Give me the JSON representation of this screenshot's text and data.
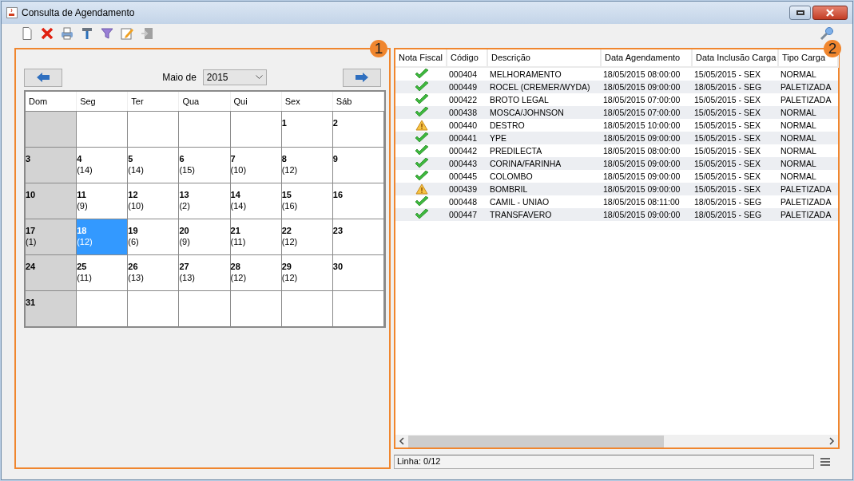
{
  "window": {
    "title": "Consulta de Agendamento"
  },
  "callouts": [
    "1",
    "2"
  ],
  "calendar": {
    "month_label": "Maio de",
    "year": "2015",
    "weekdays": [
      "Dom",
      "Seg",
      "Ter",
      "Qua",
      "Qui",
      "Sex",
      "Sáb"
    ],
    "weeks": [
      [
        {
          "kind": "blank"
        },
        {
          "kind": "blank"
        },
        {
          "kind": "blank"
        },
        {
          "kind": "blank"
        },
        {
          "kind": "blank"
        },
        {
          "kind": "day",
          "day": "1",
          "selected": false
        },
        {
          "kind": "day",
          "day": "2",
          "selected": false
        }
      ],
      [
        {
          "kind": "day",
          "day": "3",
          "selected": false
        },
        {
          "kind": "day",
          "day": "4",
          "count": "(14)",
          "selected": false
        },
        {
          "kind": "day",
          "day": "5",
          "count": "(14)",
          "selected": false
        },
        {
          "kind": "day",
          "day": "6",
          "count": "(15)",
          "selected": false
        },
        {
          "kind": "day",
          "day": "7",
          "count": "(10)",
          "selected": false
        },
        {
          "kind": "day",
          "day": "8",
          "count": "(12)",
          "selected": false
        },
        {
          "kind": "day",
          "day": "9",
          "selected": false
        }
      ],
      [
        {
          "kind": "day",
          "day": "10",
          "selected": false
        },
        {
          "kind": "day",
          "day": "11",
          "count": "(9)",
          "selected": false
        },
        {
          "kind": "day",
          "day": "12",
          "count": "(10)",
          "selected": false
        },
        {
          "kind": "day",
          "day": "13",
          "count": "(2)",
          "selected": false
        },
        {
          "kind": "day",
          "day": "14",
          "count": "(14)",
          "selected": false
        },
        {
          "kind": "day",
          "day": "15",
          "count": "(16)",
          "selected": false
        },
        {
          "kind": "day",
          "day": "16",
          "selected": false
        }
      ],
      [
        {
          "kind": "day",
          "day": "17",
          "count": "(1)",
          "selected": false
        },
        {
          "kind": "day",
          "day": "18",
          "count": "(12)",
          "selected": true
        },
        {
          "kind": "day",
          "day": "19",
          "count": "(6)",
          "selected": false
        },
        {
          "kind": "day",
          "day": "20",
          "count": "(9)",
          "selected": false
        },
        {
          "kind": "day",
          "day": "21",
          "count": "(11)",
          "selected": false
        },
        {
          "kind": "day",
          "day": "22",
          "count": "(12)",
          "selected": false
        },
        {
          "kind": "day",
          "day": "23",
          "selected": false
        }
      ],
      [
        {
          "kind": "day",
          "day": "24",
          "selected": false
        },
        {
          "kind": "day",
          "day": "25",
          "count": "(11)",
          "selected": false
        },
        {
          "kind": "day",
          "day": "26",
          "count": "(13)",
          "selected": false
        },
        {
          "kind": "day",
          "day": "27",
          "count": "(13)",
          "selected": false
        },
        {
          "kind": "day",
          "day": "28",
          "count": "(12)",
          "selected": false
        },
        {
          "kind": "day",
          "day": "29",
          "count": "(12)",
          "selected": false
        },
        {
          "kind": "day",
          "day": "30",
          "selected": false
        }
      ],
      [
        {
          "kind": "day",
          "day": "31",
          "selected": false
        },
        {
          "kind": "blank"
        },
        {
          "kind": "blank"
        },
        {
          "kind": "blank"
        },
        {
          "kind": "blank"
        },
        {
          "kind": "blank"
        },
        {
          "kind": "blank"
        }
      ]
    ]
  },
  "table": {
    "columns": [
      "Nota Fiscal",
      "Código",
      "Descrição",
      "Data Agendamento",
      "Data Inclusão Carga",
      "Tipo Carga"
    ],
    "rows": [
      {
        "kind": "ok",
        "code": "000404",
        "description": "MELHORAMENTO",
        "scheduled": "18/05/2015 08:00:00",
        "included": "15/05/2015 - SEX",
        "load_type": "NORMAL"
      },
      {
        "kind": "ok",
        "code": "000449",
        "description": "ROCEL (CREMER/WYDA)",
        "scheduled": "18/05/2015 09:00:00",
        "included": "18/05/2015 - SEG",
        "load_type": "PALETIZADA"
      },
      {
        "kind": "ok",
        "code": "000422",
        "description": "BROTO LEGAL",
        "scheduled": "18/05/2015 07:00:00",
        "included": "15/05/2015 - SEX",
        "load_type": "PALETIZADA"
      },
      {
        "kind": "ok",
        "code": "000438",
        "description": "MOSCA/JOHNSON",
        "scheduled": "18/05/2015 07:00:00",
        "included": "15/05/2015 - SEX",
        "load_type": "NORMAL"
      },
      {
        "kind": "warning",
        "code": "000440",
        "description": "DESTRO",
        "scheduled": "18/05/2015 10:00:00",
        "included": "15/05/2015 - SEX",
        "load_type": "NORMAL"
      },
      {
        "kind": "ok",
        "code": "000441",
        "description": "YPE",
        "scheduled": "18/05/2015 09:00:00",
        "included": "15/05/2015 - SEX",
        "load_type": "NORMAL"
      },
      {
        "kind": "ok",
        "code": "000442",
        "description": "PREDILECTA",
        "scheduled": "18/05/2015 08:00:00",
        "included": "15/05/2015 - SEX",
        "load_type": "NORMAL"
      },
      {
        "kind": "ok",
        "code": "000443",
        "description": "CORINA/FARINHA",
        "scheduled": "18/05/2015 09:00:00",
        "included": "15/05/2015 - SEX",
        "load_type": "NORMAL"
      },
      {
        "kind": "ok",
        "code": "000445",
        "description": "COLOMBO",
        "scheduled": "18/05/2015 09:00:00",
        "included": "15/05/2015 - SEX",
        "load_type": "NORMAL"
      },
      {
        "kind": "warning",
        "code": "000439",
        "description": "BOMBRIL",
        "scheduled": "18/05/2015 09:00:00",
        "included": "15/05/2015 - SEX",
        "load_type": "PALETIZADA"
      },
      {
        "kind": "ok",
        "code": "000448",
        "description": "CAMIL - UNIAO",
        "scheduled": "18/05/2015 08:11:00",
        "included": "18/05/2015 - SEG",
        "load_type": "PALETIZADA"
      },
      {
        "kind": "ok",
        "code": "000447",
        "description": "TRANSFAVERO",
        "scheduled": "18/05/2015 09:00:00",
        "included": "18/05/2015 - SEG",
        "load_type": "PALETIZADA"
      }
    ]
  },
  "status_bar": {
    "text": "Linha: 0/12"
  }
}
